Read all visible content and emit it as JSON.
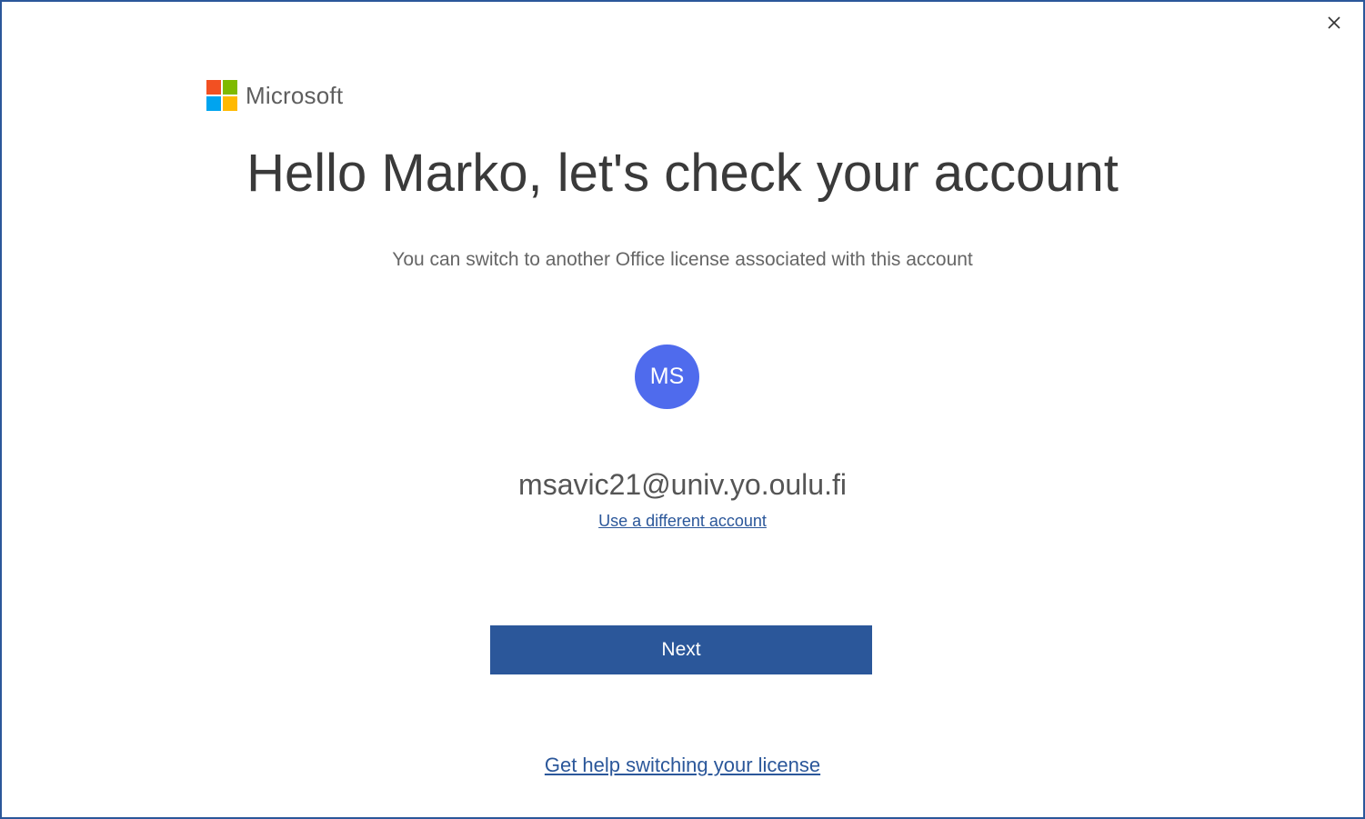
{
  "window": {
    "close_icon": "close-icon"
  },
  "brand": {
    "name": "Microsoft",
    "logo_colors": [
      "#f25022",
      "#7fba00",
      "#00a4ef",
      "#ffb900"
    ]
  },
  "heading": {
    "title": "Hello Marko, let's check your account",
    "subtitle": "You can switch to another Office license associated with this account"
  },
  "account": {
    "initials": "MS",
    "email": "msavic21@univ.yo.oulu.fi",
    "avatar_color": "#4f6bed",
    "switch_link": "Use a different account"
  },
  "actions": {
    "next_label": "Next",
    "help_link": "Get help switching your license"
  },
  "colors": {
    "accent": "#2b579a",
    "border": "#2b579a"
  }
}
